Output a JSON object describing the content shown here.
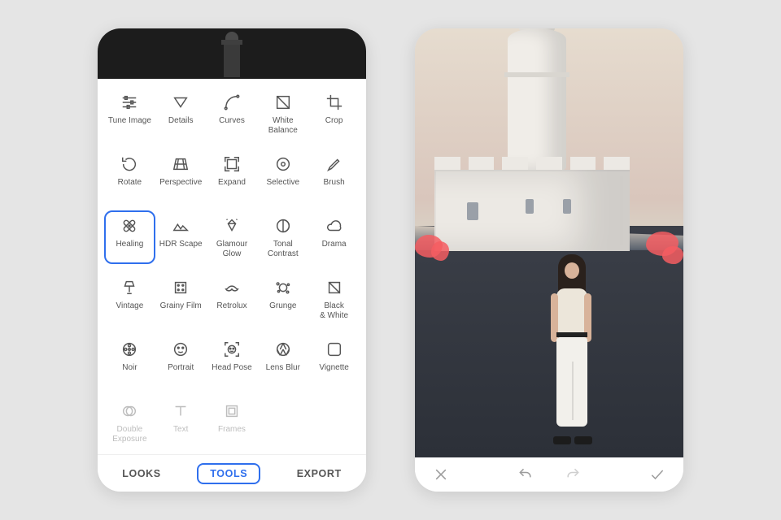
{
  "left_phone": {
    "tools": [
      {
        "id": "tune-image",
        "label": "Tune Image",
        "icon": "sliders"
      },
      {
        "id": "details",
        "label": "Details",
        "icon": "triangle-down"
      },
      {
        "id": "curves",
        "label": "Curves",
        "icon": "curve"
      },
      {
        "id": "white-balance",
        "label": "White\nBalance",
        "icon": "wb"
      },
      {
        "id": "crop",
        "label": "Crop",
        "icon": "crop"
      },
      {
        "id": "rotate",
        "label": "Rotate",
        "icon": "rotate"
      },
      {
        "id": "perspective",
        "label": "Perspective",
        "icon": "perspective"
      },
      {
        "id": "expand",
        "label": "Expand",
        "icon": "expand"
      },
      {
        "id": "selective",
        "label": "Selective",
        "icon": "target"
      },
      {
        "id": "brush",
        "label": "Brush",
        "icon": "brush"
      },
      {
        "id": "healing",
        "label": "Healing",
        "icon": "bandage",
        "selected": true
      },
      {
        "id": "hdr-scape",
        "label": "HDR Scape",
        "icon": "mountains"
      },
      {
        "id": "glamour-glow",
        "label": "Glamour\nGlow",
        "icon": "diamond-sparkle"
      },
      {
        "id": "tonal-contrast",
        "label": "Tonal\nContrast",
        "icon": "half-circle"
      },
      {
        "id": "drama",
        "label": "Drama",
        "icon": "cloud"
      },
      {
        "id": "vintage",
        "label": "Vintage",
        "icon": "lamp"
      },
      {
        "id": "grainy-film",
        "label": "Grainy Film",
        "icon": "film"
      },
      {
        "id": "retrolux",
        "label": "Retrolux",
        "icon": "mustache"
      },
      {
        "id": "grunge",
        "label": "Grunge",
        "icon": "splatter"
      },
      {
        "id": "black-white",
        "label": "Black\n& White",
        "icon": "bw"
      },
      {
        "id": "noir",
        "label": "Noir",
        "icon": "reel"
      },
      {
        "id": "portrait",
        "label": "Portrait",
        "icon": "face"
      },
      {
        "id": "head-pose",
        "label": "Head Pose",
        "icon": "face-scan"
      },
      {
        "id": "lens-blur",
        "label": "Lens Blur",
        "icon": "aperture"
      },
      {
        "id": "vignette",
        "label": "Vignette",
        "icon": "vignette"
      },
      {
        "id": "double-exposure",
        "label": "Double\nExposure",
        "icon": "rings",
        "faded": true
      },
      {
        "id": "text",
        "label": "Text",
        "icon": "text",
        "faded": true
      },
      {
        "id": "frames",
        "label": "Frames",
        "icon": "frame",
        "faded": true
      }
    ],
    "bottom_tabs": {
      "looks": "LOOKS",
      "tools": "TOOLS",
      "export": "EXPORT",
      "active": "tools"
    }
  },
  "right_phone": {
    "actions": {
      "cancel": "Cancel",
      "undo": "Undo",
      "redo": "Redo",
      "apply": "Apply"
    },
    "undo_enabled": true,
    "redo_enabled": false
  },
  "colors": {
    "accent": "#2f6fed",
    "healing_mark": "#f45d62"
  }
}
